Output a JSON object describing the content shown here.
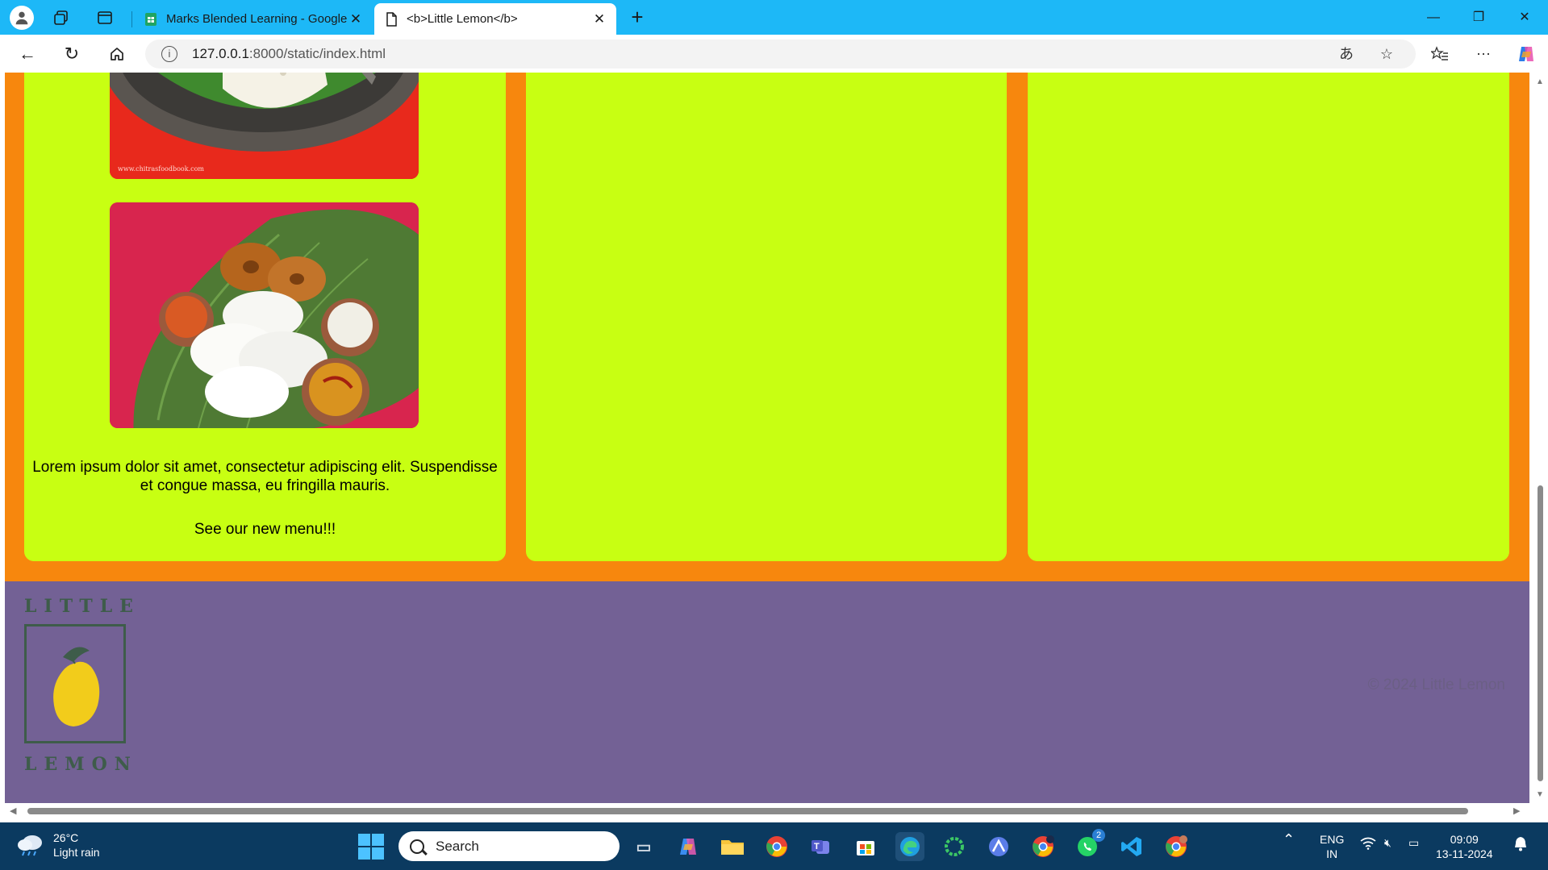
{
  "browser": {
    "tabs": [
      {
        "title": "Marks Blended Learning - Google",
        "active": false,
        "close": "✕"
      },
      {
        "title": "<b>Little Lemon</b>",
        "active": true,
        "close": "✕"
      }
    ],
    "new_tab": "+",
    "window_controls": {
      "minimize": "—",
      "restore": "❐",
      "close": "✕"
    },
    "url_host": "127.0.0.1",
    "url_path": ":8000/static/index.html"
  },
  "page": {
    "card1": {
      "image_watermark": "www.chitrasfoodbook.com",
      "description": "Lorem ipsum dolor sit amet, consectetur adipiscing elit. Suspendisse et congue massa, eu fringilla mauris.",
      "cta": "See our new menu!!!"
    },
    "footer": {
      "logo_top": "LITTLE",
      "logo_bottom": "LEMON",
      "copyright": "© 2024 Little Lemon"
    },
    "colors": {
      "section_bg": "#f7870d",
      "card_bg": "#c8ff12",
      "footer_bg": "#736195",
      "logo_green": "#3e5c4a",
      "lemon_yellow": "#f2cc1b"
    }
  },
  "taskbar": {
    "weather_temp": "26°C",
    "weather_desc": "Light rain",
    "search_placeholder": "Search",
    "whatsapp_badge": "2",
    "lang_top": "ENG",
    "lang_bottom": "IN",
    "time": "09:09",
    "date": "13-11-2024",
    "apps": [
      "task-view",
      "copilot",
      "file-explorer",
      "chrome",
      "teams",
      "microsoft-store",
      "edge",
      "loader-app",
      "vector-app",
      "chrome-profile",
      "whatsapp",
      "vscode",
      "chrome-user"
    ]
  }
}
